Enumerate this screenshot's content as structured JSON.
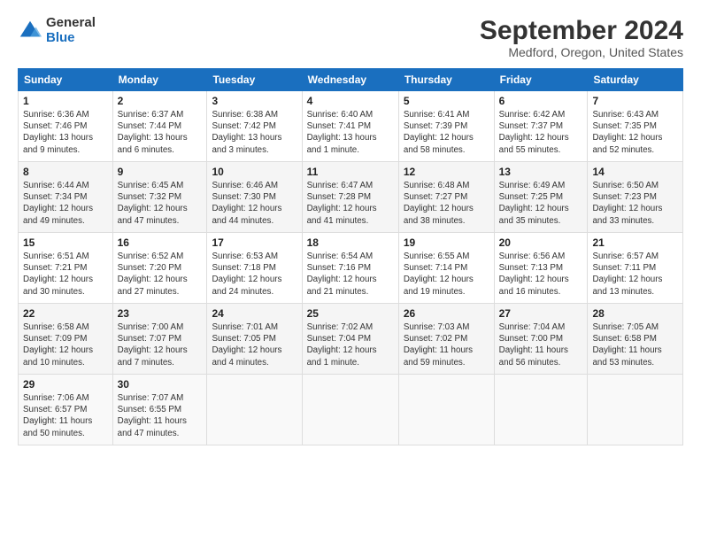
{
  "header": {
    "logo_general": "General",
    "logo_blue": "Blue",
    "title": "September 2024",
    "location": "Medford, Oregon, United States"
  },
  "weekdays": [
    "Sunday",
    "Monday",
    "Tuesday",
    "Wednesday",
    "Thursday",
    "Friday",
    "Saturday"
  ],
  "weeks": [
    [
      {
        "day": "1",
        "info": "Sunrise: 6:36 AM\nSunset: 7:46 PM\nDaylight: 13 hours\nand 9 minutes."
      },
      {
        "day": "2",
        "info": "Sunrise: 6:37 AM\nSunset: 7:44 PM\nDaylight: 13 hours\nand 6 minutes."
      },
      {
        "day": "3",
        "info": "Sunrise: 6:38 AM\nSunset: 7:42 PM\nDaylight: 13 hours\nand 3 minutes."
      },
      {
        "day": "4",
        "info": "Sunrise: 6:40 AM\nSunset: 7:41 PM\nDaylight: 13 hours\nand 1 minute."
      },
      {
        "day": "5",
        "info": "Sunrise: 6:41 AM\nSunset: 7:39 PM\nDaylight: 12 hours\nand 58 minutes."
      },
      {
        "day": "6",
        "info": "Sunrise: 6:42 AM\nSunset: 7:37 PM\nDaylight: 12 hours\nand 55 minutes."
      },
      {
        "day": "7",
        "info": "Sunrise: 6:43 AM\nSunset: 7:35 PM\nDaylight: 12 hours\nand 52 minutes."
      }
    ],
    [
      {
        "day": "8",
        "info": "Sunrise: 6:44 AM\nSunset: 7:34 PM\nDaylight: 12 hours\nand 49 minutes."
      },
      {
        "day": "9",
        "info": "Sunrise: 6:45 AM\nSunset: 7:32 PM\nDaylight: 12 hours\nand 47 minutes."
      },
      {
        "day": "10",
        "info": "Sunrise: 6:46 AM\nSunset: 7:30 PM\nDaylight: 12 hours\nand 44 minutes."
      },
      {
        "day": "11",
        "info": "Sunrise: 6:47 AM\nSunset: 7:28 PM\nDaylight: 12 hours\nand 41 minutes."
      },
      {
        "day": "12",
        "info": "Sunrise: 6:48 AM\nSunset: 7:27 PM\nDaylight: 12 hours\nand 38 minutes."
      },
      {
        "day": "13",
        "info": "Sunrise: 6:49 AM\nSunset: 7:25 PM\nDaylight: 12 hours\nand 35 minutes."
      },
      {
        "day": "14",
        "info": "Sunrise: 6:50 AM\nSunset: 7:23 PM\nDaylight: 12 hours\nand 33 minutes."
      }
    ],
    [
      {
        "day": "15",
        "info": "Sunrise: 6:51 AM\nSunset: 7:21 PM\nDaylight: 12 hours\nand 30 minutes."
      },
      {
        "day": "16",
        "info": "Sunrise: 6:52 AM\nSunset: 7:20 PM\nDaylight: 12 hours\nand 27 minutes."
      },
      {
        "day": "17",
        "info": "Sunrise: 6:53 AM\nSunset: 7:18 PM\nDaylight: 12 hours\nand 24 minutes."
      },
      {
        "day": "18",
        "info": "Sunrise: 6:54 AM\nSunset: 7:16 PM\nDaylight: 12 hours\nand 21 minutes."
      },
      {
        "day": "19",
        "info": "Sunrise: 6:55 AM\nSunset: 7:14 PM\nDaylight: 12 hours\nand 19 minutes."
      },
      {
        "day": "20",
        "info": "Sunrise: 6:56 AM\nSunset: 7:13 PM\nDaylight: 12 hours\nand 16 minutes."
      },
      {
        "day": "21",
        "info": "Sunrise: 6:57 AM\nSunset: 7:11 PM\nDaylight: 12 hours\nand 13 minutes."
      }
    ],
    [
      {
        "day": "22",
        "info": "Sunrise: 6:58 AM\nSunset: 7:09 PM\nDaylight: 12 hours\nand 10 minutes."
      },
      {
        "day": "23",
        "info": "Sunrise: 7:00 AM\nSunset: 7:07 PM\nDaylight: 12 hours\nand 7 minutes."
      },
      {
        "day": "24",
        "info": "Sunrise: 7:01 AM\nSunset: 7:05 PM\nDaylight: 12 hours\nand 4 minutes."
      },
      {
        "day": "25",
        "info": "Sunrise: 7:02 AM\nSunset: 7:04 PM\nDaylight: 12 hours\nand 1 minute."
      },
      {
        "day": "26",
        "info": "Sunrise: 7:03 AM\nSunset: 7:02 PM\nDaylight: 11 hours\nand 59 minutes."
      },
      {
        "day": "27",
        "info": "Sunrise: 7:04 AM\nSunset: 7:00 PM\nDaylight: 11 hours\nand 56 minutes."
      },
      {
        "day": "28",
        "info": "Sunrise: 7:05 AM\nSunset: 6:58 PM\nDaylight: 11 hours\nand 53 minutes."
      }
    ],
    [
      {
        "day": "29",
        "info": "Sunrise: 7:06 AM\nSunset: 6:57 PM\nDaylight: 11 hours\nand 50 minutes."
      },
      {
        "day": "30",
        "info": "Sunrise: 7:07 AM\nSunset: 6:55 PM\nDaylight: 11 hours\nand 47 minutes."
      },
      {
        "day": "",
        "info": ""
      },
      {
        "day": "",
        "info": ""
      },
      {
        "day": "",
        "info": ""
      },
      {
        "day": "",
        "info": ""
      },
      {
        "day": "",
        "info": ""
      }
    ]
  ]
}
